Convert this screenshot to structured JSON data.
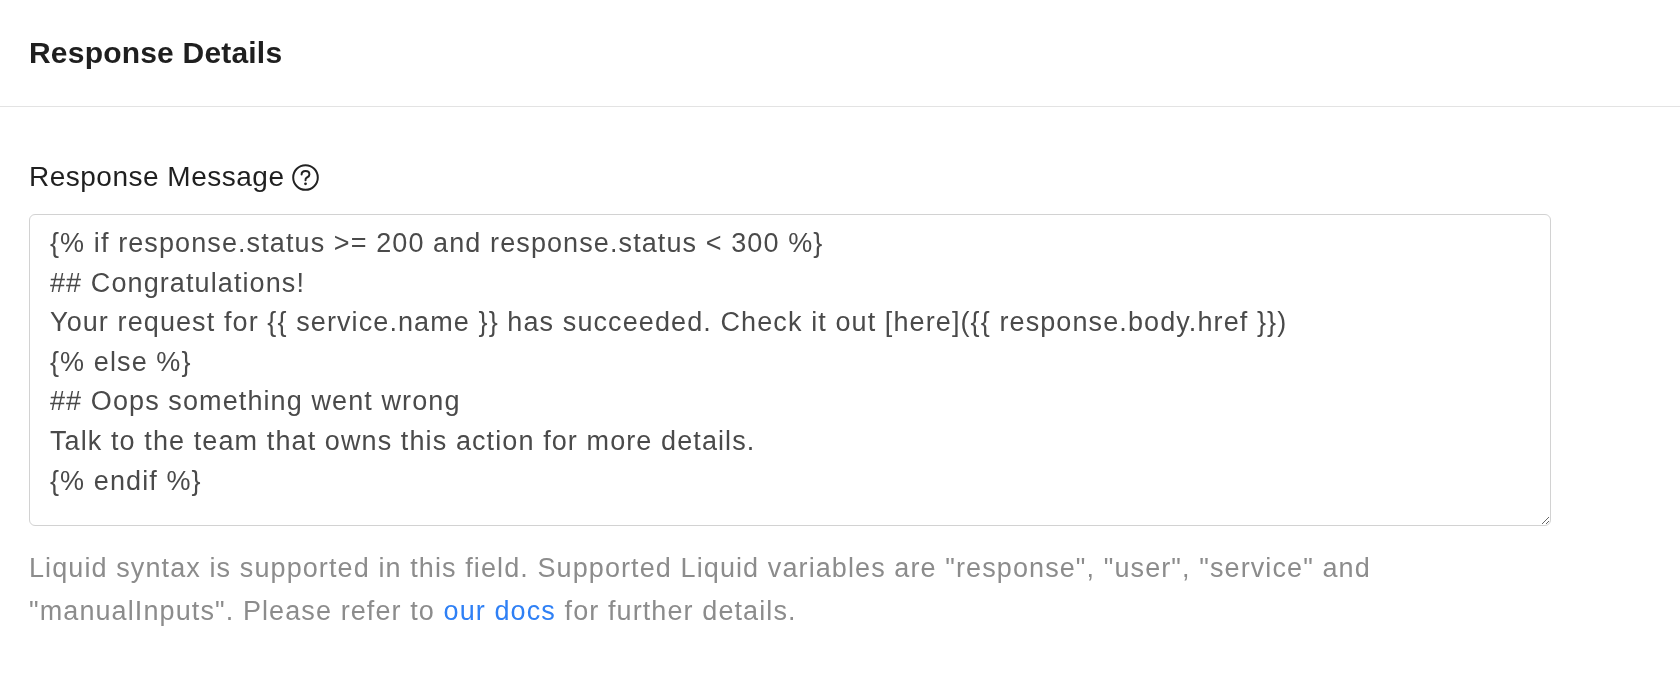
{
  "header": {
    "title": "Response Details"
  },
  "field": {
    "label": "Response Message",
    "value": "{% if response.status >= 200 and response.status < 300 %}\n## Congratulations!\nYour request for {{ service.name }} has succeeded. Check it out [here]({{ response.body.href }})\n{% else %}\n## Oops something went wrong\nTalk to the team that owns this action for more details.\n{% endif %}",
    "help": {
      "text_before": "Liquid syntax is supported in this field. Supported Liquid variables are \"response\", \"user\", \"service\" and \"manualInputs\". Please refer to ",
      "link": "our docs",
      "text_after": " for further details."
    }
  }
}
